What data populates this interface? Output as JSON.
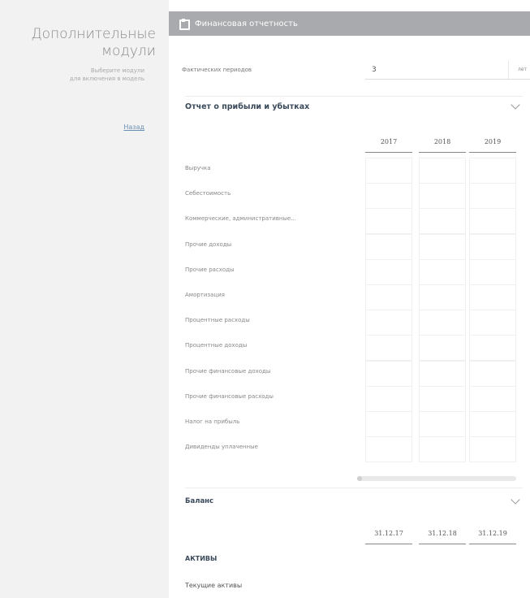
{
  "sidebar": {
    "title_line1": "Дополнительные",
    "title_line2": "модули",
    "subtitle_line1": "Выберите модули",
    "subtitle_line2": "для включения в модель",
    "link": "Назад"
  },
  "panel": {
    "header_title": "Финансовая отчетность",
    "header_icon": "building-icon",
    "periods_label": "Фактических периодов",
    "periods_value": "3",
    "periods_unit": "лет",
    "pnl_title": "Отчет о прибыли и убытках",
    "years": [
      "2017",
      "2018",
      "2019"
    ],
    "pnl_rows": [
      "Выручка",
      "Себестоимость",
      "Коммерческие, административные...",
      "Прочие доходы",
      "Прочие расходы",
      "Амортизация",
      "Процентные расходы",
      "Процентные доходы",
      "Прочие финансовые доходы",
      "Прочие финансовые расходы",
      "Налог на прибыль",
      "Дивиденды уплаченные"
    ],
    "balance_title": "Баланс",
    "balance_dates": [
      "31.12.17",
      "31.12.18",
      "31.12.19"
    ],
    "assets_label": "АКТИВЫ",
    "current_assets_label": "Текущие активы"
  }
}
